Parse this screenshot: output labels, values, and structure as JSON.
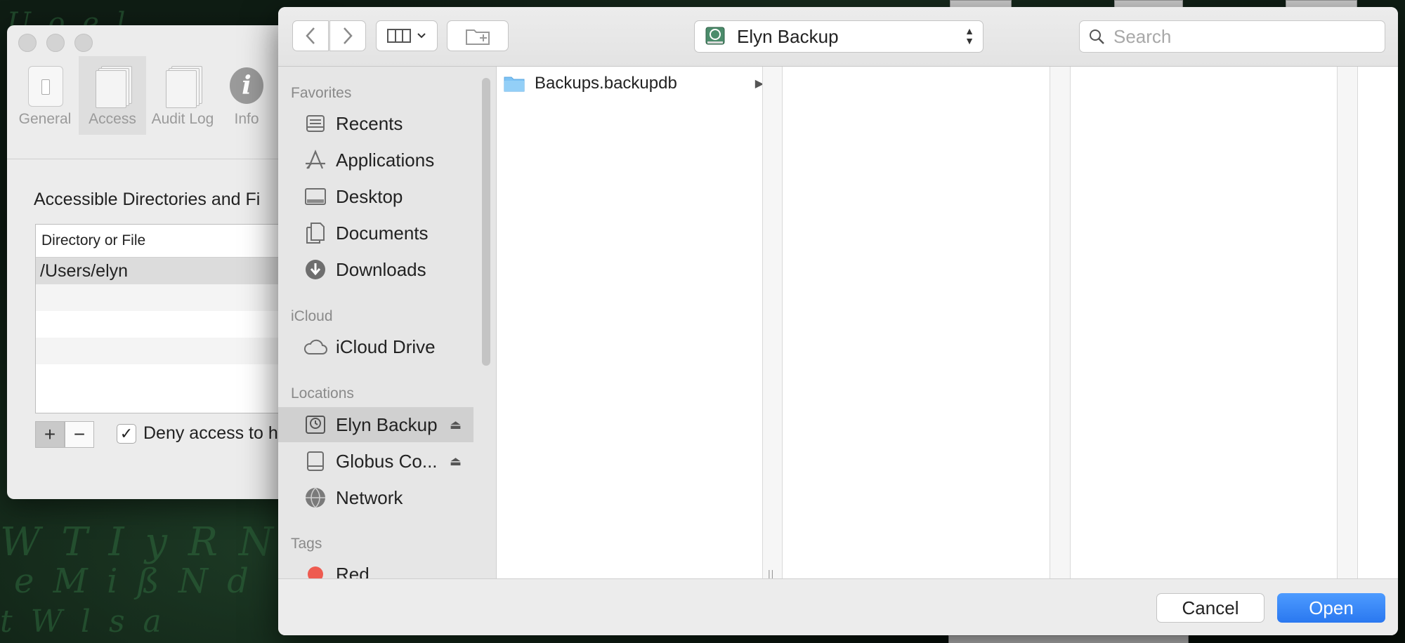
{
  "background_window": {
    "tabs": [
      {
        "label": "General",
        "icon": "switch-icon"
      },
      {
        "label": "Access",
        "icon": "documents-icon"
      },
      {
        "label": "Audit Log",
        "icon": "log-icon"
      },
      {
        "label": "Info",
        "icon": "info-icon"
      }
    ],
    "active_tab": "Access",
    "heading": "Accessible Directories and Fi",
    "table": {
      "column_header": "Directory or File",
      "rows": [
        "/Users/elyn"
      ]
    },
    "add_label": "+",
    "remove_label": "−",
    "deny_checkbox": {
      "checked": true,
      "check_glyph": "✓",
      "label": "Deny access to h"
    }
  },
  "dialog": {
    "location": "Elyn Backup",
    "search_placeholder": "Search",
    "sidebar": {
      "sections": [
        {
          "heading": "Favorites",
          "items": [
            {
              "label": "Recents",
              "icon": "recents-icon"
            },
            {
              "label": "Applications",
              "icon": "applications-icon"
            },
            {
              "label": "Desktop",
              "icon": "desktop-icon"
            },
            {
              "label": "Documents",
              "icon": "documents-icon"
            },
            {
              "label": "Downloads",
              "icon": "downloads-icon"
            }
          ]
        },
        {
          "heading": "iCloud",
          "items": [
            {
              "label": "iCloud Drive",
              "icon": "cloud-icon"
            }
          ]
        },
        {
          "heading": "Locations",
          "items": [
            {
              "label": "Elyn Backup",
              "icon": "time-machine-drive-icon",
              "selected": true,
              "eject": true
            },
            {
              "label": "Globus Co...",
              "icon": "drive-icon",
              "eject": true
            },
            {
              "label": "Network",
              "icon": "network-icon"
            }
          ]
        },
        {
          "heading": "Tags",
          "items": [
            {
              "label": "Red",
              "icon": "tag-red-icon",
              "color": "#ee5b50"
            }
          ]
        }
      ]
    },
    "files": [
      {
        "name": "Backups.backupdb",
        "type": "folder",
        "has_children": true
      }
    ],
    "cancel_label": "Cancel",
    "open_label": "Open",
    "colors": {
      "accent": "#2a78f0",
      "tag_red": "#ee5b50"
    }
  }
}
